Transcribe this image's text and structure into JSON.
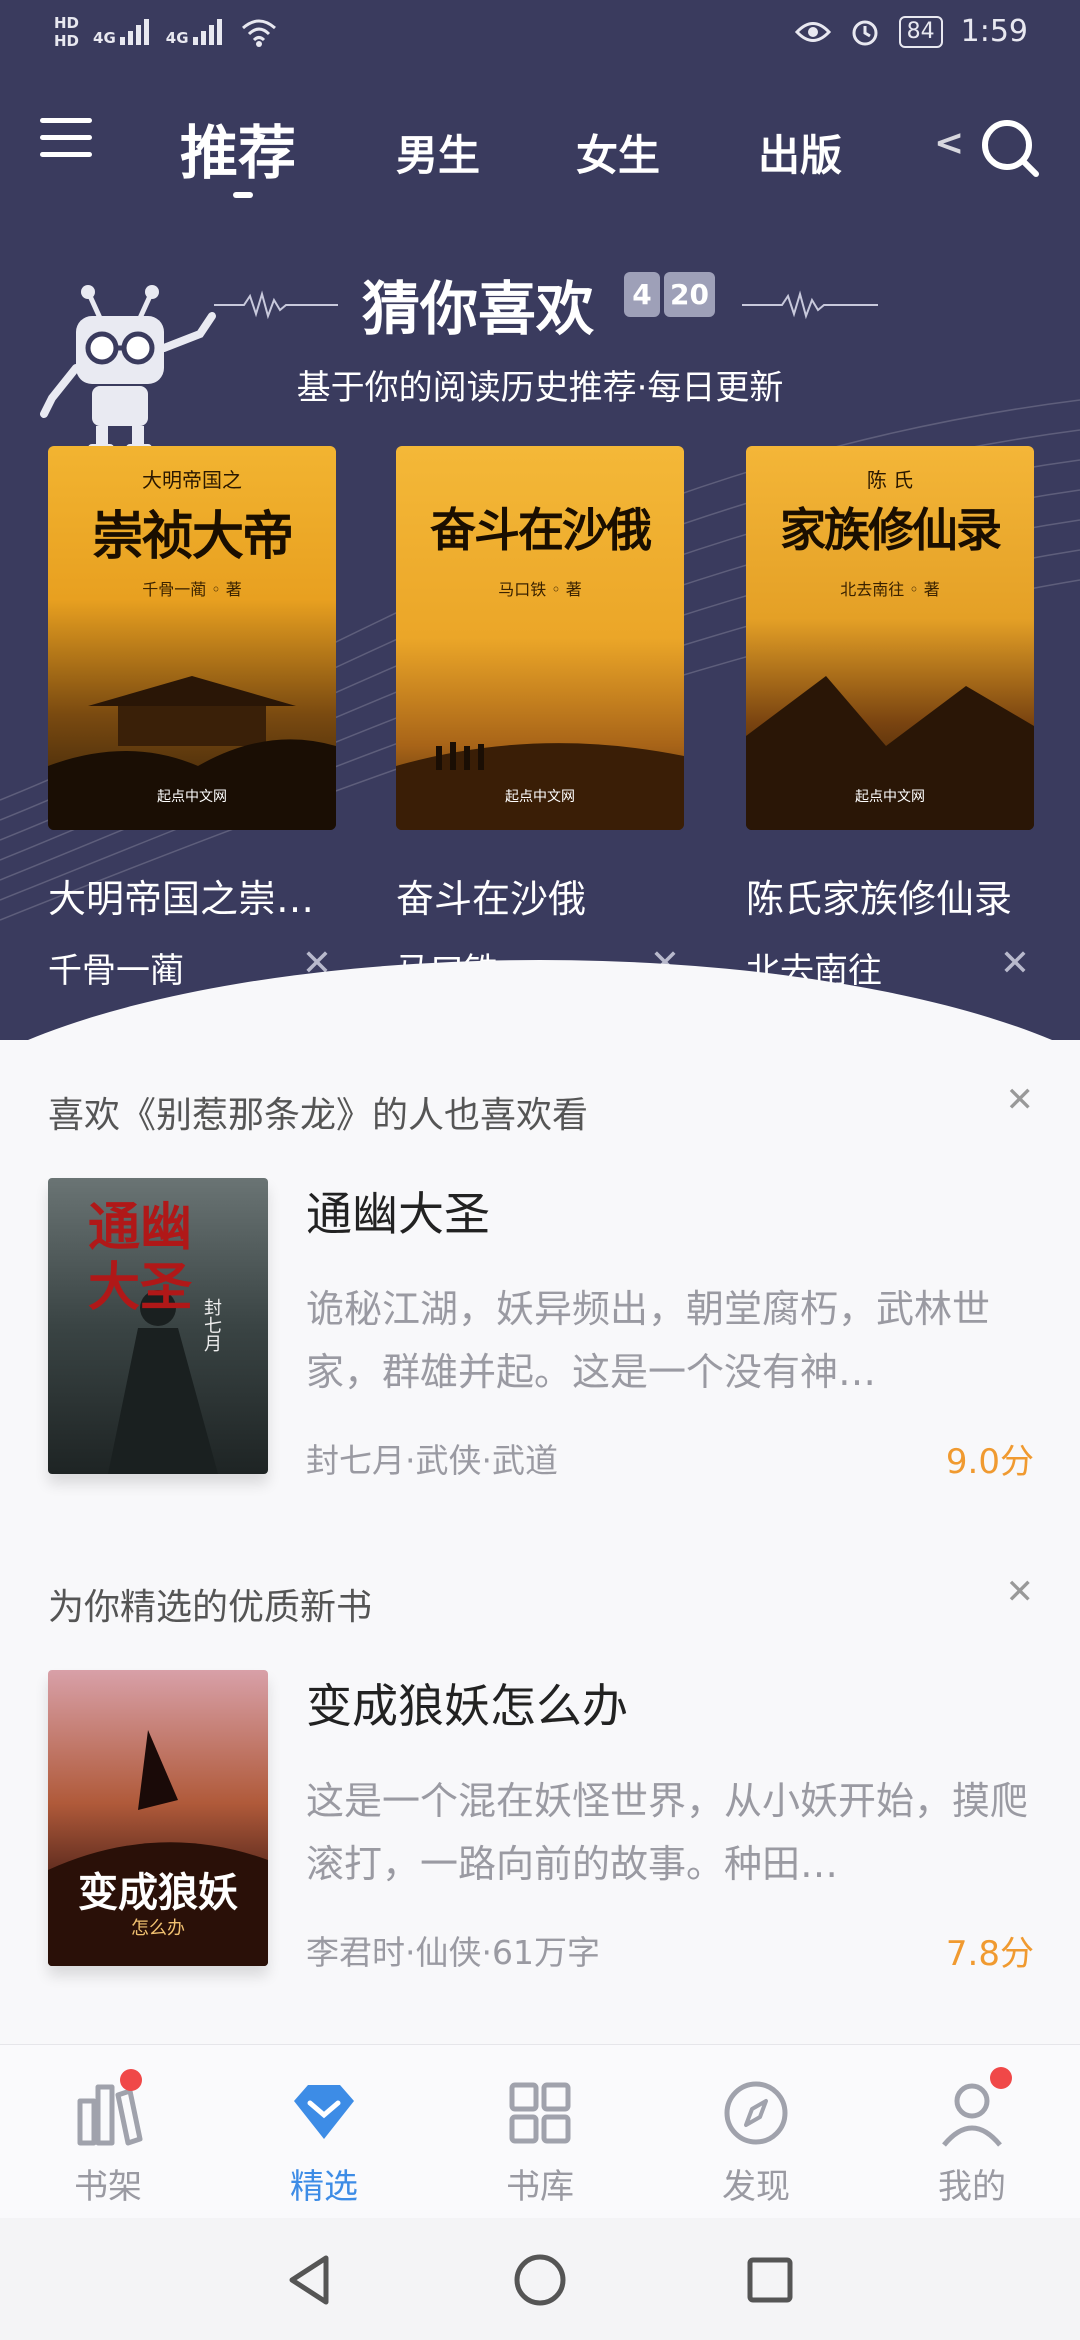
{
  "status_bar": {
    "net_left_top": "HD",
    "net_left_bottom": "HD",
    "sig1": "4G",
    "sig2": "4G",
    "battery": "84",
    "time": "1:59"
  },
  "top_nav": {
    "tabs": [
      "推荐",
      "男生",
      "女生",
      "出版",
      "<"
    ]
  },
  "guess": {
    "title": "猜你喜欢",
    "date_month": "4",
    "date_day": "20",
    "subtitle": "基于你的阅读历史推荐·每日更新",
    "books": [
      {
        "cover_small": "大明帝国之",
        "cover_title": "崇祯大帝",
        "cover_author": "千骨一蔺 ◦ 著",
        "cover_pub": "起点中文网",
        "name": "大明帝国之崇祯大帝",
        "author": "千骨一蔺"
      },
      {
        "cover_small": "",
        "cover_title": "奋斗在沙俄",
        "cover_author": "马口铁 ◦ 著",
        "cover_pub": "起点中文网",
        "name": "奋斗在沙俄",
        "author": "马口铁"
      },
      {
        "cover_small": "陈 氏",
        "cover_title": "家族修仙录",
        "cover_author": "北去南往 ◦ 著",
        "cover_pub": "起点中文网",
        "name": "陈氏家族修仙录",
        "author": "北去南往"
      }
    ],
    "close_symbol": "✕"
  },
  "cards": [
    {
      "reason": "喜欢《别惹那条龙》的人也喜欢看",
      "title": "通幽大圣",
      "desc": "诡秘江湖，妖异频出，朝堂腐朽，武林世家，群雄并起。这是一个没有神…",
      "meta": "封七月·武侠·武道",
      "score": "9.0分",
      "cover_text": "通幽大圣",
      "cover_sub": "封七月"
    },
    {
      "reason": "为你精选的优质新书",
      "title": "变成狼妖怎么办",
      "desc": "这是一个混在妖怪世界，从小妖开始，摸爬滚打，一路向前的故事。种田…",
      "meta": "李君时·仙侠·61万字",
      "score": "7.8分",
      "cover_text": "变成狼妖",
      "cover_sub": "怎么办"
    }
  ],
  "bottom_nav": {
    "items": [
      {
        "label": "书架",
        "icon": "bookshelf-icon",
        "badge": true
      },
      {
        "label": "精选",
        "icon": "diamond-icon",
        "active": true
      },
      {
        "label": "书库",
        "icon": "grid-icon"
      },
      {
        "label": "发现",
        "icon": "compass-icon"
      },
      {
        "label": "我的",
        "icon": "user-icon",
        "badge": true
      }
    ]
  },
  "colors": {
    "header_bg": "#3a3b5e",
    "accent": "#3d8ce6",
    "score": "#f09a30",
    "badge": "#f04848"
  }
}
